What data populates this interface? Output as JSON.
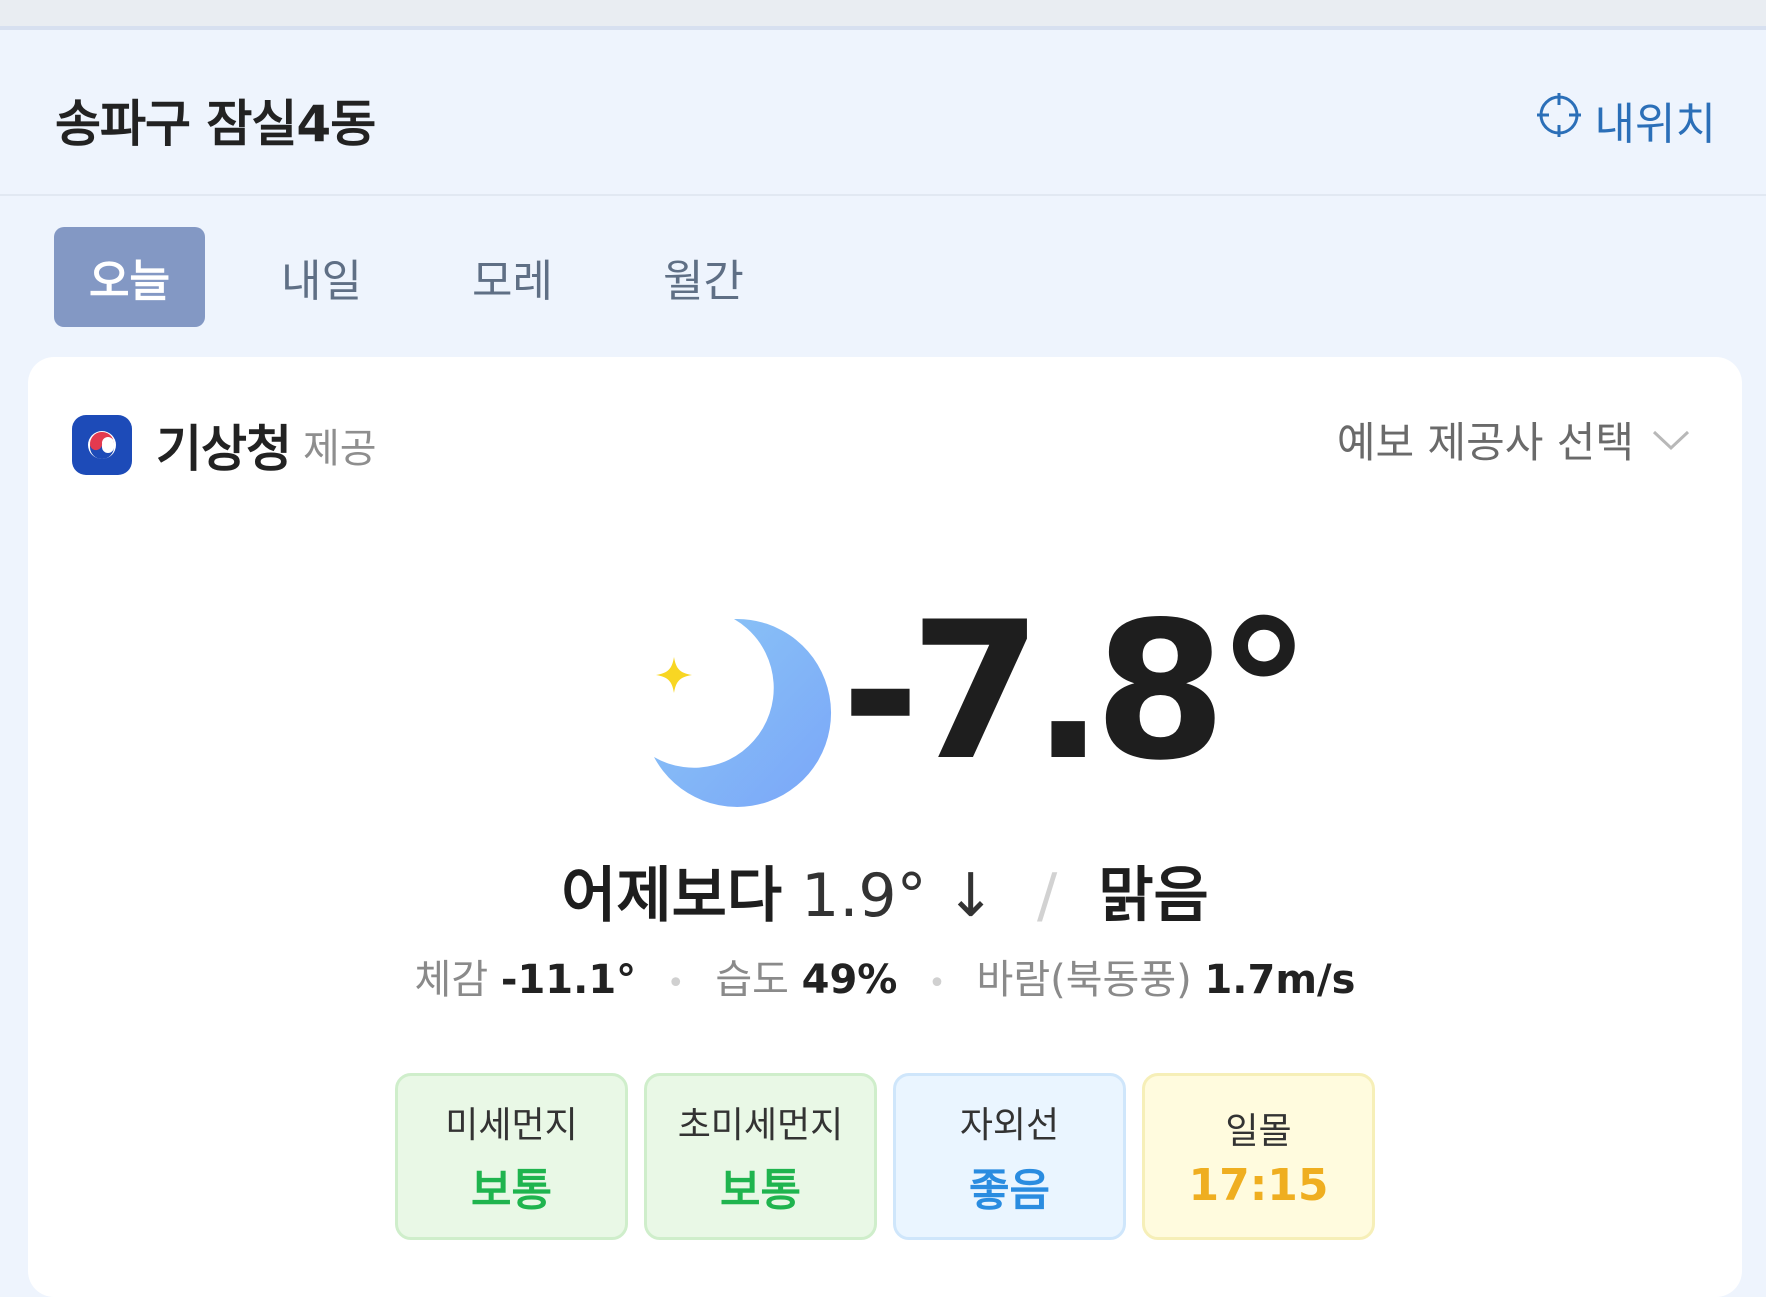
{
  "header": {
    "location": "송파구 잠실4동",
    "my_location_label": "내위치",
    "my_location_icon": "crosshair-icon"
  },
  "tabs": [
    {
      "label": "오늘",
      "active": true
    },
    {
      "label": "내일",
      "active": false
    },
    {
      "label": "모레",
      "active": false
    },
    {
      "label": "월간",
      "active": false
    }
  ],
  "provider": {
    "name": "기상청",
    "suffix": "제공",
    "logo_icon": "kma-logo-icon",
    "selector_label": "예보 제공사 선택",
    "selector_icon": "chevron-down-icon"
  },
  "current": {
    "icon": "crescent-moon-icon",
    "temperature": "-7.8°",
    "compare_prefix": "어제보다",
    "compare_value": "1.9°",
    "compare_arrow": "↓",
    "separator": "/",
    "condition": "맑음"
  },
  "details": {
    "feels_label": "체감",
    "feels_value": "-11.1°",
    "humidity_label": "습도",
    "humidity_value": "49%",
    "wind_label": "바람(북동풍)",
    "wind_value": "1.7m/s",
    "dot": "•"
  },
  "chips": [
    {
      "label": "미세먼지",
      "value": "보통",
      "tone": "green",
      "color": "#1fb44e"
    },
    {
      "label": "초미세먼지",
      "value": "보통",
      "tone": "green",
      "color": "#1fb44e"
    },
    {
      "label": "자외선",
      "value": "좋음",
      "tone": "blue",
      "color": "#2a8ce0"
    },
    {
      "label": "일몰",
      "value": "17:15",
      "tone": "yellow",
      "color": "#efae20"
    }
  ],
  "colors": {
    "page_bg": "#eef4fd",
    "active_tab": "#8398c4",
    "link_blue": "#2b6fb8",
    "moon": "#7fb2f8",
    "star": "#f8d623"
  }
}
